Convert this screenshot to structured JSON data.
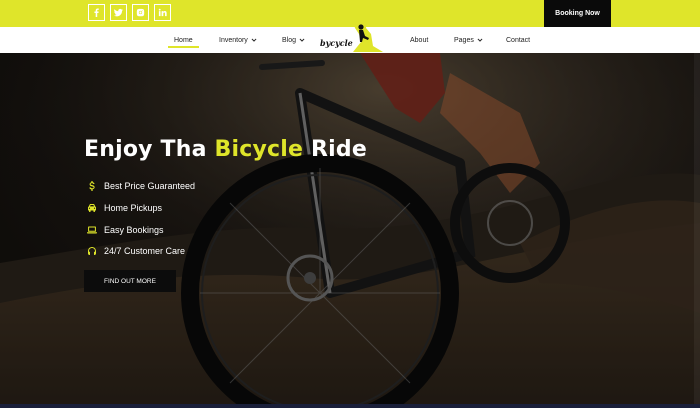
{
  "topbar": {
    "socials": [
      {
        "icon": "facebook-icon"
      },
      {
        "icon": "twitter-icon"
      },
      {
        "icon": "instagram-icon"
      },
      {
        "icon": "linkedin-icon"
      }
    ],
    "booking_label": "Booking Now"
  },
  "nav": {
    "items": [
      {
        "label": "Home",
        "active": true
      },
      {
        "label": "Inventory",
        "dropdown": true
      },
      {
        "label": "Blog",
        "dropdown": true
      },
      {
        "label": "About"
      },
      {
        "label": "Pages",
        "dropdown": true
      },
      {
        "label": "Contact"
      }
    ],
    "logo_text": "bycycle"
  },
  "hero": {
    "title_before": "Enjoy Tha ",
    "title_highlight": "Bicycle",
    "title_after": " Ride",
    "features": [
      {
        "icon": "dollar-icon",
        "label": "Best Price Guaranteed"
      },
      {
        "icon": "car-icon",
        "label": "Home Pickups"
      },
      {
        "icon": "laptop-icon",
        "label": "Easy Bookings"
      },
      {
        "icon": "headphones-icon",
        "label": "24/7 Customer Care"
      }
    ],
    "cta_label": "FIND OUT MORE"
  },
  "colors": {
    "accent": "#dfe52a",
    "dark": "#0a0a0a",
    "text_light": "#ffffff"
  }
}
